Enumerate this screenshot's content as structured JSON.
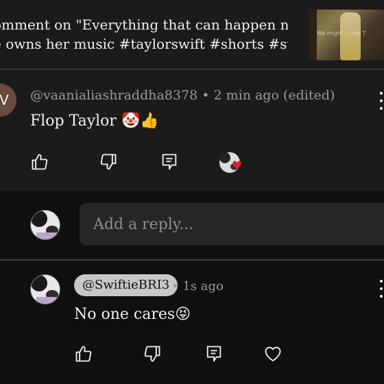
{
  "header": {
    "line1": "omment on \"Everything that can happen now that",
    "line2": "e owns her music #taylorswift #shorts #swifties #f...",
    "thumbnail_caption": "We might ... rep T"
  },
  "comment1": {
    "avatar_letter": "V",
    "author": "@vaanialiashraddha8378",
    "separator": "•",
    "time": "2 min ago (edited)",
    "text": "Flop Taylor",
    "emojis": "🤡👍",
    "heart_badge": "♥"
  },
  "reply": {
    "placeholder": "Add a reply..."
  },
  "comment2": {
    "mention": "@SwiftieBRI3",
    "separator": "•",
    "time": "1s ago",
    "text": "No one cares",
    "emoji": "😝"
  },
  "icons": {
    "like": "like-icon",
    "dislike": "dislike-icon",
    "reply": "reply-icon",
    "heart": "heart-icon",
    "more": "more-vert-icon"
  },
  "colors": {
    "background": "#0f0f0f",
    "card": "#1b1b1b",
    "muted_text": "#9a9a9a",
    "heart_red": "#e51e2a",
    "mention_chip": "#c7c7c7"
  }
}
